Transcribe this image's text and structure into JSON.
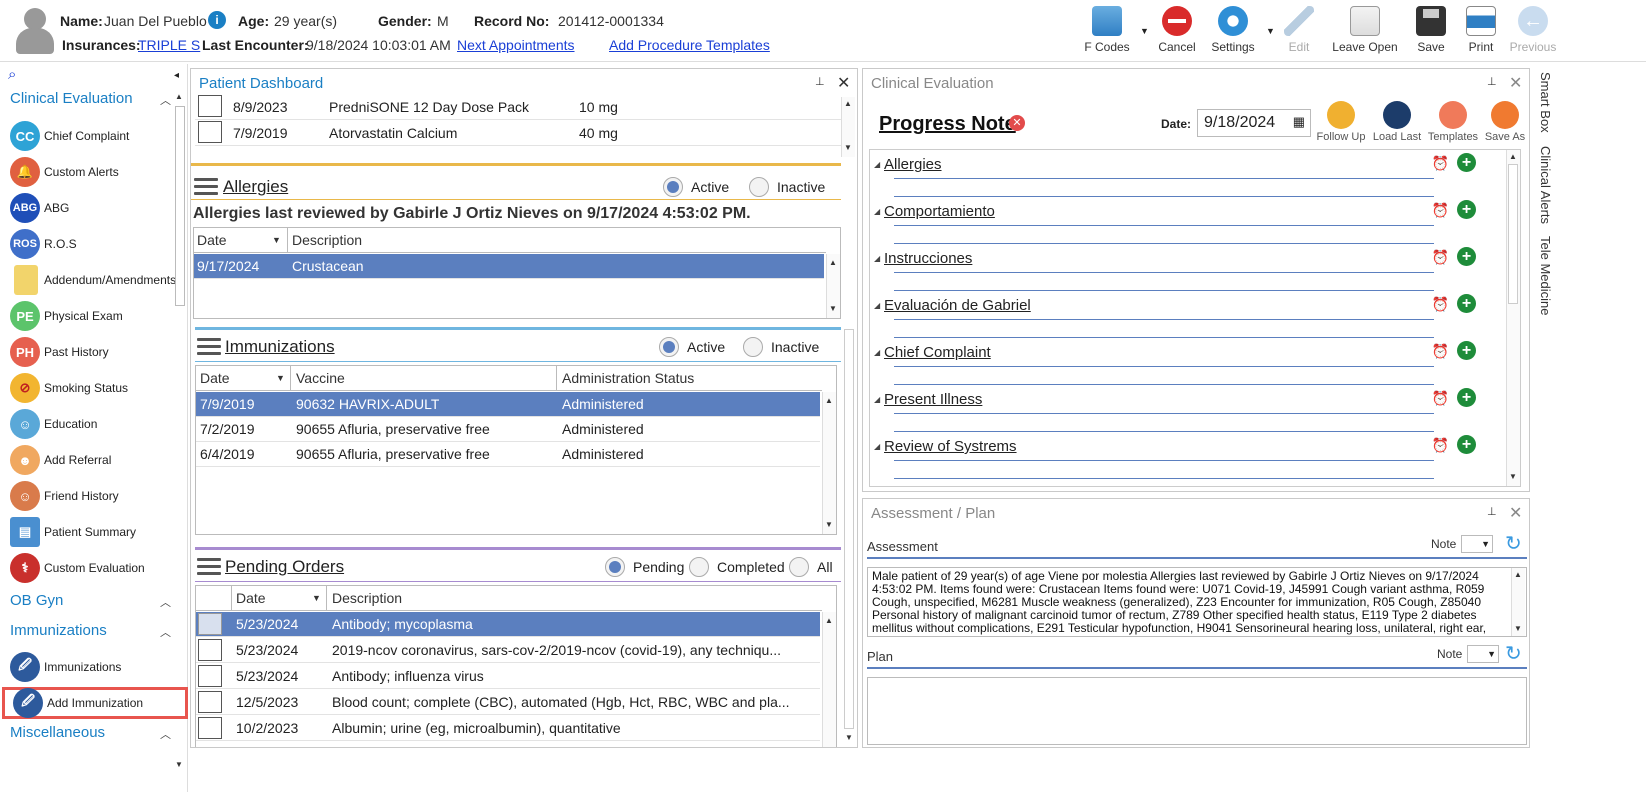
{
  "header": {
    "name_label": "Name:",
    "name_value": "Juan Del Pueblo",
    "age_label": "Age:",
    "age_value": "29 year(s)",
    "gender_label": "Gender:",
    "gender_value": "M",
    "record_label": "Record No:",
    "record_value": "201412-0001334",
    "insurances_label": "Insurances:",
    "insurances_value": "TRIPLE S",
    "last_encounter_label": "Last Encounter:",
    "last_encounter_value": "9/18/2024 10:03:01 AM",
    "next_appointments": "Next Appointments",
    "add_procedure_templates": "Add Procedure Templates"
  },
  "toolbar": {
    "fcodes": "F Codes",
    "cancel": "Cancel",
    "settings": "Settings",
    "edit": "Edit",
    "leave_open": "Leave Open",
    "save": "Save",
    "print": "Print",
    "previous": "Previous"
  },
  "sidebar": {
    "sec_clinical": "Clinical Evaluation",
    "sec_obgyn": "OB Gyn",
    "sec_immunizations": "Immunizations",
    "sec_misc": "Miscellaneous",
    "items": [
      {
        "label": "Chief Complaint",
        "icon": "CC"
      },
      {
        "label": "Custom Alerts",
        "icon": ""
      },
      {
        "label": "ABG",
        "icon": "ABG"
      },
      {
        "label": "R.O.S",
        "icon": "ROS"
      },
      {
        "label": "Addendum/Amendments",
        "icon": ""
      },
      {
        "label": "Physical Exam",
        "icon": "PE"
      },
      {
        "label": "Past History",
        "icon": "PH"
      },
      {
        "label": "Smoking Status",
        "icon": ""
      },
      {
        "label": "Education",
        "icon": ""
      },
      {
        "label": "Add Referral",
        "icon": ""
      },
      {
        "label": "Friend History",
        "icon": ""
      },
      {
        "label": "Patient Summary",
        "icon": ""
      },
      {
        "label": "Custom Evaluation",
        "icon": ""
      }
    ],
    "imm_items": [
      "Immunizations",
      "Add Immunization"
    ]
  },
  "dashboard": {
    "title": "Patient Dashboard",
    "meds": [
      {
        "date": "8/9/2023",
        "name": "PredniSONE 12 Day Dose Pack",
        "dose": "10 mg"
      },
      {
        "date": "7/9/2019",
        "name": "Atorvastatin Calcium",
        "dose": "40 mg"
      }
    ],
    "allergies": {
      "title": "Allergies",
      "active": "Active",
      "inactive": "Inactive",
      "reviewed": "Allergies last reviewed by Gabirle J Ortiz Nieves on 9/17/2024 4:53:02 PM.",
      "col_date": "Date",
      "col_desc": "Description",
      "rows": [
        {
          "date": "9/17/2024",
          "desc": "Crustacean"
        }
      ]
    },
    "immunizations": {
      "title": "Immunizations",
      "active": "Active",
      "inactive": "Inactive",
      "col_date": "Date",
      "col_vaccine": "Vaccine",
      "col_status": "Administration Status",
      "rows": [
        {
          "date": "7/9/2019",
          "vaccine": "90632 HAVRIX-ADULT",
          "status": "Administered"
        },
        {
          "date": "7/2/2019",
          "vaccine": "90655 Afluria, preservative free",
          "status": "Administered"
        },
        {
          "date": "6/4/2019",
          "vaccine": "90655 Afluria, preservative free",
          "status": "Administered"
        }
      ]
    },
    "pending": {
      "title": "Pending Orders",
      "pending": "Pending",
      "completed": "Completed",
      "all": "All",
      "col_date": "Date",
      "col_desc": "Description",
      "rows": [
        {
          "date": "5/23/2024",
          "desc": "Antibody; mycoplasma"
        },
        {
          "date": "5/23/2024",
          "desc": "2019-ncov coronavirus, sars-cov-2/2019-ncov (covid-19), any techniqu..."
        },
        {
          "date": "5/23/2024",
          "desc": "Antibody; influenza virus"
        },
        {
          "date": "12/5/2023",
          "desc": "Blood count; complete (CBC), automated (Hgb, Hct, RBC, WBC and pla..."
        },
        {
          "date": "10/2/2023",
          "desc": "Albumin; urine (eg, microalbumin), quantitative"
        }
      ]
    }
  },
  "clinical": {
    "title": "Clinical Evaluation",
    "note_title": "Progress Note",
    "date_label": "Date:",
    "date_value": "9/18/2024",
    "buttons": [
      "Follow Up",
      "Load Last",
      "Templates",
      "Save As"
    ],
    "sections": [
      "Allergies",
      "Comportamiento",
      "Instrucciones",
      "Evaluación de Gabriel",
      "Chief Complaint",
      "Present Illness",
      "Review of Systrems"
    ]
  },
  "assessment": {
    "title": "Assessment / Plan",
    "assessment_label": "Assessment",
    "plan_label": "Plan",
    "note_label": "Note",
    "note_label2": "Note",
    "text": "Male patient of 29 year(s) of age Viene por molestia     Allergies last reviewed by Gabirle J Ortiz Nieves on 9/17/2024 4:53:02 PM.    Items found were:  Crustacean  Items found were:  U071 Covid-19, J45991 Cough variant asthma, R059 Cough, unspecified, M6281 Muscle weakness (generalized), Z23 Encounter for immunization, R05 Cough, Z85040 Personal history of malignant carcinoid tumor of rectum, Z789 Other specified health status, E119 Type 2 diabetes mellitus without complications, E291 Testicular hypofunction, H9041 Sensorineural hearing loss, unilateral, right ear, with"
  },
  "side_tabs": [
    "Smart Box",
    "Clinical Alerts",
    "Tele Medicine"
  ],
  "colors": {
    "accent": "#1a7fc4",
    "selected": "#5b7fbf",
    "highlight": "#e8554e"
  }
}
